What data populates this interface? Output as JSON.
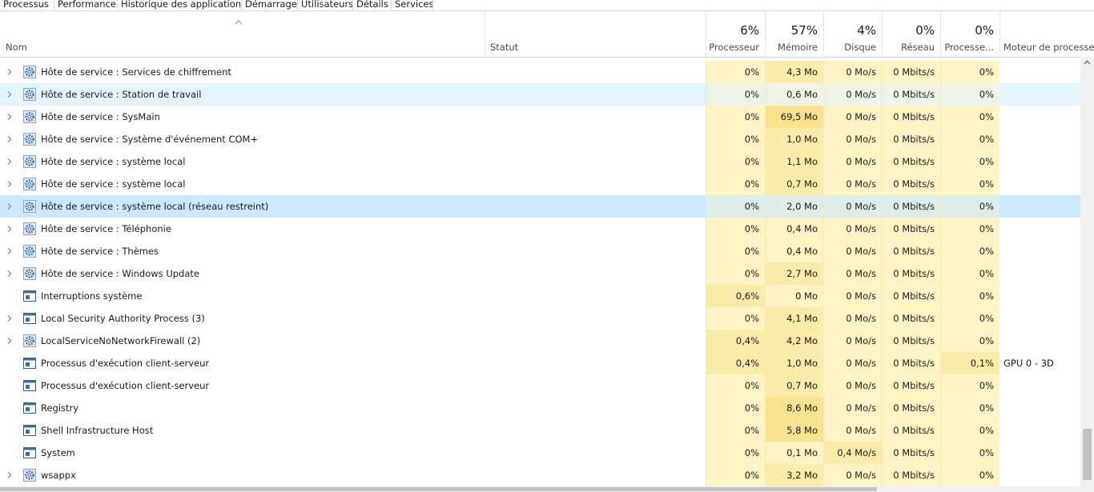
{
  "tabs": [
    "Processus",
    "Performance",
    "Historique des applications",
    "Démarrage",
    "Utilisateurs",
    "Détails",
    "Services"
  ],
  "header": {
    "name_label": "Nom",
    "status_label": "Statut",
    "cpu_pct": "6%",
    "cpu_label": "Processeur",
    "mem_pct": "57%",
    "mem_label": "Mémoire",
    "disk_pct": "4%",
    "disk_label": "Disque",
    "net_pct": "0%",
    "net_label": "Réseau",
    "gpu_pct": "0%",
    "gpu_label": "Processe...",
    "gpu_engine_label": "Moteur de processeur"
  },
  "colors": {
    "heat_light": "#fff4c4",
    "heat_medium": "#f9eca8",
    "heat_strong": "#f7e38e",
    "row_hover": "#e5f3fb",
    "row_selected": "#cce8ff"
  },
  "rows": [
    {
      "name": "Hôte de service : Services de chiffrement",
      "expandable": true,
      "icon": "gear-icon",
      "cpu": "0%",
      "mem": "4,3 Mo",
      "disk": "0 Mo/s",
      "net": "0 Mbits/s",
      "gpu": "0%",
      "gpu_engine": "",
      "state": ""
    },
    {
      "name": "Hôte de service : Station de travail",
      "expandable": true,
      "icon": "gear-icon",
      "cpu": "0%",
      "mem": "0,6 Mo",
      "disk": "0 Mo/s",
      "net": "0 Mbits/s",
      "gpu": "0%",
      "gpu_engine": "",
      "state": "hover"
    },
    {
      "name": "Hôte de service : SysMain",
      "expandable": true,
      "icon": "gear-icon",
      "cpu": "0%",
      "mem": "69,5 Mo",
      "disk": "0 Mo/s",
      "net": "0 Mbits/s",
      "gpu": "0%",
      "gpu_engine": "",
      "state": ""
    },
    {
      "name": "Hôte de service : Système d'événement COM+",
      "expandable": true,
      "icon": "gear-icon",
      "cpu": "0%",
      "mem": "1,0 Mo",
      "disk": "0 Mo/s",
      "net": "0 Mbits/s",
      "gpu": "0%",
      "gpu_engine": "",
      "state": ""
    },
    {
      "name": "Hôte de service : système local",
      "expandable": true,
      "icon": "gear-icon",
      "cpu": "0%",
      "mem": "1,1 Mo",
      "disk": "0 Mo/s",
      "net": "0 Mbits/s",
      "gpu": "0%",
      "gpu_engine": "",
      "state": ""
    },
    {
      "name": "Hôte de service : système local",
      "expandable": true,
      "icon": "gear-icon",
      "cpu": "0%",
      "mem": "0,7 Mo",
      "disk": "0 Mo/s",
      "net": "0 Mbits/s",
      "gpu": "0%",
      "gpu_engine": "",
      "state": ""
    },
    {
      "name": "Hôte de service : système local (réseau restreint)",
      "expandable": true,
      "icon": "gear-icon",
      "cpu": "0%",
      "mem": "2,0 Mo",
      "disk": "0 Mo/s",
      "net": "0 Mbits/s",
      "gpu": "0%",
      "gpu_engine": "",
      "state": "selected"
    },
    {
      "name": "Hôte de service : Téléphonie",
      "expandable": true,
      "icon": "gear-icon",
      "cpu": "0%",
      "mem": "0,4 Mo",
      "disk": "0 Mo/s",
      "net": "0 Mbits/s",
      "gpu": "0%",
      "gpu_engine": "",
      "state": ""
    },
    {
      "name": "Hôte de service : Thèmes",
      "expandable": true,
      "icon": "gear-icon",
      "cpu": "0%",
      "mem": "0,4 Mo",
      "disk": "0 Mo/s",
      "net": "0 Mbits/s",
      "gpu": "0%",
      "gpu_engine": "",
      "state": ""
    },
    {
      "name": "Hôte de service : Windows Update",
      "expandable": true,
      "icon": "gear-icon",
      "cpu": "0%",
      "mem": "2,7 Mo",
      "disk": "0 Mo/s",
      "net": "0 Mbits/s",
      "gpu": "0%",
      "gpu_engine": "",
      "state": ""
    },
    {
      "name": "Interruptions système",
      "expandable": false,
      "icon": "window-icon",
      "cpu": "0,6%",
      "mem": "0 Mo",
      "disk": "0 Mo/s",
      "net": "0 Mbits/s",
      "gpu": "0%",
      "gpu_engine": "",
      "state": ""
    },
    {
      "name": "Local Security Authority Process (3)",
      "expandable": true,
      "icon": "window-icon",
      "cpu": "0%",
      "mem": "4,1 Mo",
      "disk": "0 Mo/s",
      "net": "0 Mbits/s",
      "gpu": "0%",
      "gpu_engine": "",
      "state": ""
    },
    {
      "name": "LocalServiceNoNetworkFirewall (2)",
      "expandable": true,
      "icon": "gear-icon",
      "cpu": "0,4%",
      "mem": "4,2 Mo",
      "disk": "0 Mo/s",
      "net": "0 Mbits/s",
      "gpu": "0%",
      "gpu_engine": "",
      "state": ""
    },
    {
      "name": "Processus d'exécution client-serveur",
      "expandable": false,
      "icon": "window-icon",
      "cpu": "0,4%",
      "mem": "1,0 Mo",
      "disk": "0 Mo/s",
      "net": "0 Mbits/s",
      "gpu": "0,1%",
      "gpu_engine": "GPU 0 - 3D",
      "state": ""
    },
    {
      "name": "Processus d'exécution client-serveur",
      "expandable": false,
      "icon": "window-icon",
      "cpu": "0%",
      "mem": "0,7 Mo",
      "disk": "0 Mo/s",
      "net": "0 Mbits/s",
      "gpu": "0%",
      "gpu_engine": "",
      "state": ""
    },
    {
      "name": "Registry",
      "expandable": false,
      "icon": "window-icon",
      "cpu": "0%",
      "mem": "8,6 Mo",
      "disk": "0 Mo/s",
      "net": "0 Mbits/s",
      "gpu": "0%",
      "gpu_engine": "",
      "state": ""
    },
    {
      "name": "Shell Infrastructure Host",
      "expandable": false,
      "icon": "window-icon",
      "cpu": "0%",
      "mem": "5,8 Mo",
      "disk": "0 Mo/s",
      "net": "0 Mbits/s",
      "gpu": "0%",
      "gpu_engine": "",
      "state": ""
    },
    {
      "name": "System",
      "expandable": false,
      "icon": "window-icon",
      "cpu": "0%",
      "mem": "0,1 Mo",
      "disk": "0,4 Mo/s",
      "net": "0 Mbits/s",
      "gpu": "0%",
      "gpu_engine": "",
      "state": ""
    },
    {
      "name": "wsappx",
      "expandable": true,
      "icon": "gear-icon",
      "cpu": "0%",
      "mem": "3,2 Mo",
      "disk": "0 Mo/s",
      "net": "0 Mbits/s",
      "gpu": "0%",
      "gpu_engine": "",
      "state": ""
    }
  ]
}
